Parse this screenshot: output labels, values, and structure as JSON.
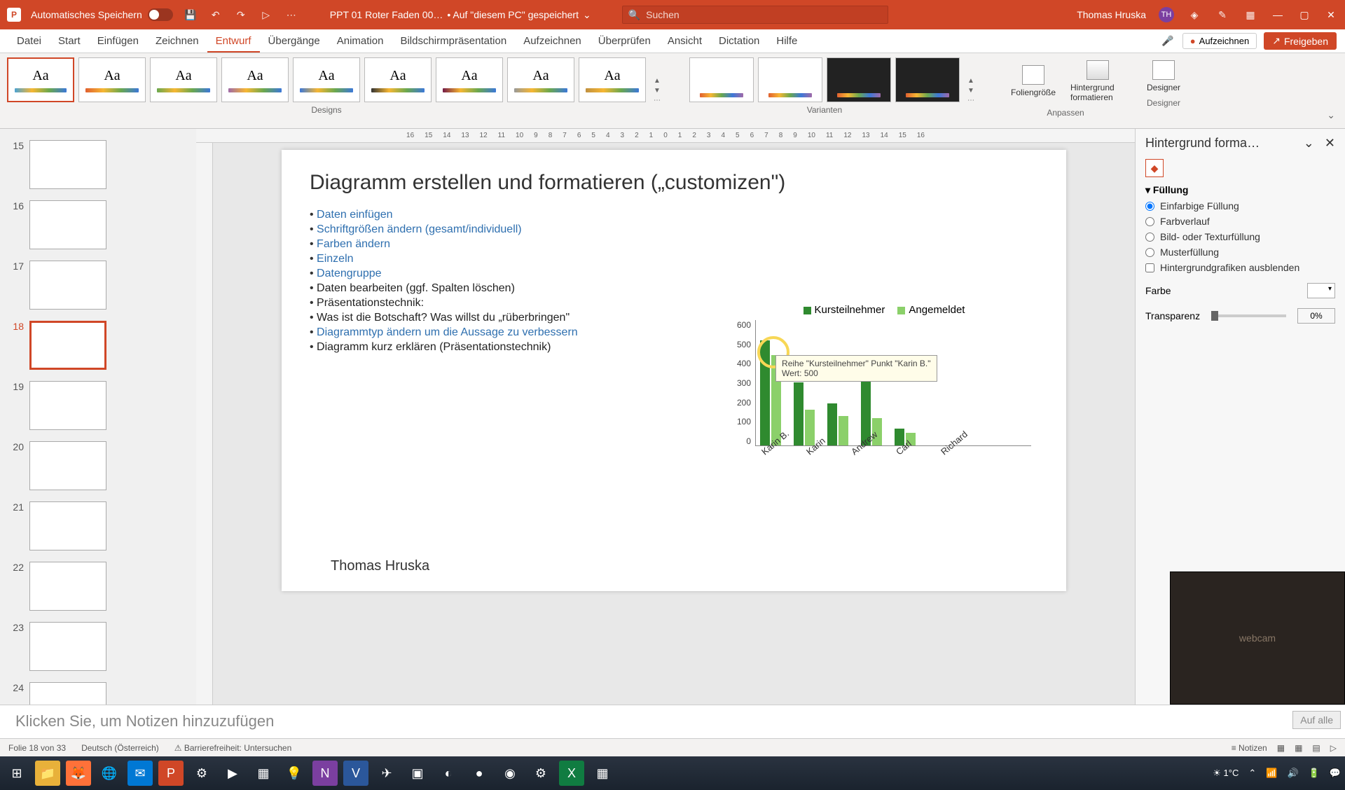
{
  "titlebar": {
    "autosave": "Automatisches Speichern",
    "doc": "PPT 01 Roter Faden 00…",
    "saved": "• Auf \"diesem PC\" gespeichert",
    "search_placeholder": "Suchen",
    "user": "Thomas Hruska",
    "initials": "TH"
  },
  "tabs": [
    "Datei",
    "Start",
    "Einfügen",
    "Zeichnen",
    "Entwurf",
    "Übergänge",
    "Animation",
    "Bildschirmpräsentation",
    "Aufzeichnen",
    "Überprüfen",
    "Ansicht",
    "Dictation",
    "Hilfe"
  ],
  "active_tab": "Entwurf",
  "ribbon": {
    "record": "Aufzeichnen",
    "share": "Freigeben",
    "designs": "Designs",
    "variants": "Varianten",
    "slide_size": "Foliengröße",
    "format_bg": "Hintergrund formatieren",
    "designer": "Designer",
    "adjust": "Anpassen"
  },
  "ruler_labels": [
    "16",
    "15",
    "14",
    "13",
    "12",
    "11",
    "10",
    "9",
    "8",
    "7",
    "6",
    "5",
    "4",
    "3",
    "2",
    "1",
    "0",
    "1",
    "2",
    "3",
    "4",
    "5",
    "6",
    "7",
    "8",
    "9",
    "10",
    "11",
    "12",
    "13",
    "14",
    "15",
    "16"
  ],
  "thumbs": [
    {
      "n": "15"
    },
    {
      "n": "16"
    },
    {
      "n": "17"
    },
    {
      "n": "18",
      "sel": true
    },
    {
      "n": "19"
    },
    {
      "n": "20"
    },
    {
      "n": "21"
    },
    {
      "n": "22"
    },
    {
      "n": "23"
    },
    {
      "n": "24"
    }
  ],
  "slide": {
    "title": "Diagramm erstellen und formatieren („customizen\")",
    "items": [
      {
        "lvl": 1,
        "txt": "Daten einfügen",
        "link": true
      },
      {
        "lvl": 1,
        "txt": "Schriftgrößen ändern (gesamt/individuell)",
        "link": true
      },
      {
        "lvl": 1,
        "txt": "Farben ändern",
        "link": true
      },
      {
        "lvl": 2,
        "txt": "Einzeln",
        "link": true
      },
      {
        "lvl": 2,
        "txt": "Datengruppe",
        "link": true
      },
      {
        "lvl": 1,
        "txt": "Daten bearbeiten (ggf. Spalten löschen)",
        "link": false
      },
      {
        "lvl": 0,
        "txt": "Präsentationstechnik:",
        "link": false
      },
      {
        "lvl": 1,
        "txt": "Was ist die Botschaft? Was willst du „rüberbringen\"",
        "link": false
      },
      {
        "lvl": 2,
        "txt": "Diagrammtyp ändern um die Aussage zu verbessern",
        "link": true
      },
      {
        "lvl": 1,
        "txt": "Diagramm kurz erklären (Präsentationstechnik)",
        "link": false
      }
    ],
    "author": "Thomas Hruska"
  },
  "chart_data": {
    "type": "bar",
    "categories": [
      "Karin B.",
      "Karin",
      "Andrew",
      "Carl",
      "Richard"
    ],
    "series": [
      {
        "name": "Kursteilnehmer",
        "values": [
          500,
          300,
          200,
          400,
          80
        ]
      },
      {
        "name": "Angemeldet",
        "values": [
          430,
          170,
          140,
          130,
          60
        ]
      }
    ],
    "ylim": [
      0,
      600
    ],
    "yticks": [
      "600",
      "500",
      "400",
      "300",
      "200",
      "100",
      "0"
    ],
    "tooltip_line1": "Reihe \"Kursteilnehmer\" Punkt \"Karin B.\"",
    "tooltip_line2": "Wert: 500"
  },
  "pane": {
    "title": "Hintergrund forma…",
    "section": "Füllung",
    "opt_solid": "Einfarbige Füllung",
    "opt_grad": "Farbverlauf",
    "opt_pic": "Bild- oder Texturfüllung",
    "opt_pattern": "Musterfüllung",
    "opt_hide": "Hintergrundgrafiken ausblenden",
    "color": "Farbe",
    "trans": "Transparenz",
    "trans_val": "0%",
    "apply_all": "Auf alle"
  },
  "notes": "Klicken Sie, um Notizen hinzuzufügen",
  "status": {
    "slide": "Folie 18 von 33",
    "lang": "Deutsch (Österreich)",
    "access": "Barrierefreiheit: Untersuchen",
    "notes_btn": "Notizen"
  },
  "taskbar": {
    "temp": "1°C",
    "time": ""
  }
}
